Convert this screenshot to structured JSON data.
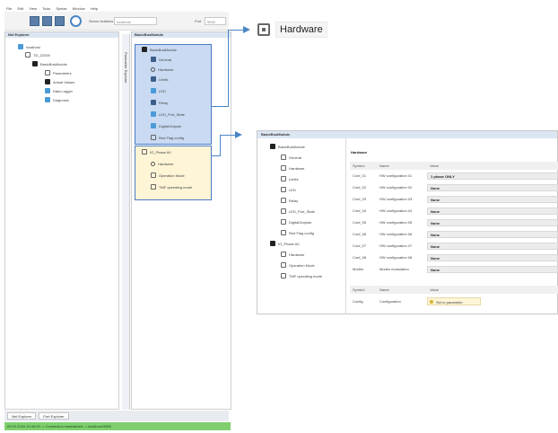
{
  "menu": [
    "File",
    "Edit",
    "View",
    "Tools",
    "Syntax",
    "Window",
    "Help"
  ],
  "toolbar": {
    "server_label": "Server Address",
    "server_value": "localhost",
    "port_label": "Port",
    "port_value": "5555"
  },
  "explorer": {
    "title": "Net Explorer",
    "items": [
      {
        "label": "localhost",
        "depth": 0,
        "icon": "computer-icon"
      },
      {
        "label": "TD_Z2000",
        "depth": 1,
        "icon": "network-icon"
      },
      {
        "label": "BasicBusModule",
        "depth": 2,
        "icon": "module-icon"
      },
      {
        "label": "Parameters",
        "depth": 3,
        "icon": "parameters-icon"
      },
      {
        "label": "Actual Values",
        "depth": 3,
        "icon": "values-icon"
      },
      {
        "label": "Data Logger",
        "depth": 3,
        "icon": "logger-icon"
      },
      {
        "label": "Diagnosis",
        "depth": 3,
        "icon": "diagnosis-icon"
      }
    ]
  },
  "side_tab_label": "Parameter Explorer",
  "params_panel": {
    "title": "BasicBusModule",
    "blue_items": [
      {
        "label": "BasicBusModule",
        "icon": "module-icon"
      },
      {
        "label": "General",
        "icon": "info-icon"
      },
      {
        "label": "Hardware",
        "icon": "gear-icon"
      },
      {
        "label": "Limits",
        "icon": "limits-icon"
      },
      {
        "label": "LED",
        "icon": "led-icon"
      },
      {
        "label": "Relay",
        "icon": "relay-icon"
      },
      {
        "label": "LED_Port_State",
        "icon": "port-icon"
      },
      {
        "label": "DigitalOutputs",
        "icon": "output-icon"
      },
      {
        "label": "Red Flag config",
        "icon": "flag-icon"
      }
    ],
    "yellow_items": [
      {
        "label": "IO_Phase A0",
        "icon": "phase-icon"
      },
      {
        "label": "Hardware",
        "icon": "gear-icon"
      },
      {
        "label": "Operation Mode",
        "icon": "mode-icon"
      },
      {
        "label": "TMF operating mode",
        "icon": "mode-icon"
      }
    ]
  },
  "hardware_callout": {
    "title": "Hardware"
  },
  "zoom_panel": {
    "title": "BasicBusModule",
    "section_title": "Hardware",
    "tree": [
      {
        "label": "BasicBusModule",
        "depth": 0
      },
      {
        "label": "General",
        "depth": 1
      },
      {
        "label": "Hardware",
        "depth": 1
      },
      {
        "label": "Limits",
        "depth": 1
      },
      {
        "label": "LED",
        "depth": 1
      },
      {
        "label": "Relay",
        "depth": 1
      },
      {
        "label": "LED_Port_State",
        "depth": 1
      },
      {
        "label": "DigitalOutputs",
        "depth": 1
      },
      {
        "label": "Red Flag config",
        "depth": 1
      },
      {
        "label": "IO_Phase A0",
        "depth": 0
      },
      {
        "label": "Hardware",
        "depth": 1
      },
      {
        "label": "Operation Mode",
        "depth": 1
      },
      {
        "label": "TMF operating mode",
        "depth": 1
      }
    ],
    "columns": [
      "Symbol",
      "Name",
      "Value"
    ],
    "rows": [
      {
        "symbol": "Conf_01",
        "name": "HW configuration 01",
        "value": "1 phase ONLY"
      },
      {
        "symbol": "Conf_02",
        "name": "HW configuration 02",
        "value": "None"
      },
      {
        "symbol": "Conf_03",
        "name": "HW configuration 03",
        "value": "None"
      },
      {
        "symbol": "Conf_04",
        "name": "HW configuration 04",
        "value": "None"
      },
      {
        "symbol": "Conf_05",
        "name": "HW configuration 05",
        "value": "None"
      },
      {
        "symbol": "Conf_06",
        "name": "HW configuration 06",
        "value": "None"
      },
      {
        "symbol": "Conf_07",
        "name": "HW configuration 07",
        "value": "None"
      },
      {
        "symbol": "Conf_08",
        "name": "HW configuration 08",
        "value": "None"
      },
      {
        "symbol": "Modes",
        "name": "Modes modulation",
        "value": "None"
      }
    ],
    "columns2": [
      "Symbol",
      "Name",
      "Value"
    ],
    "config_row": {
      "symbol": "Config",
      "name": "Configuration",
      "value": "Set to parameter"
    }
  },
  "bottom_tabs": [
    "Net Explorer",
    "Port Explorer"
  ],
  "status_text": "09.03.2016 15:40:29 -> Connection established -> localhost:5555",
  "colors": {
    "accent": "#4a86c5",
    "status_green": "#7fcf6e",
    "highlight_blue": "#c9daf2",
    "highlight_yellow": "#fdf5d6"
  }
}
